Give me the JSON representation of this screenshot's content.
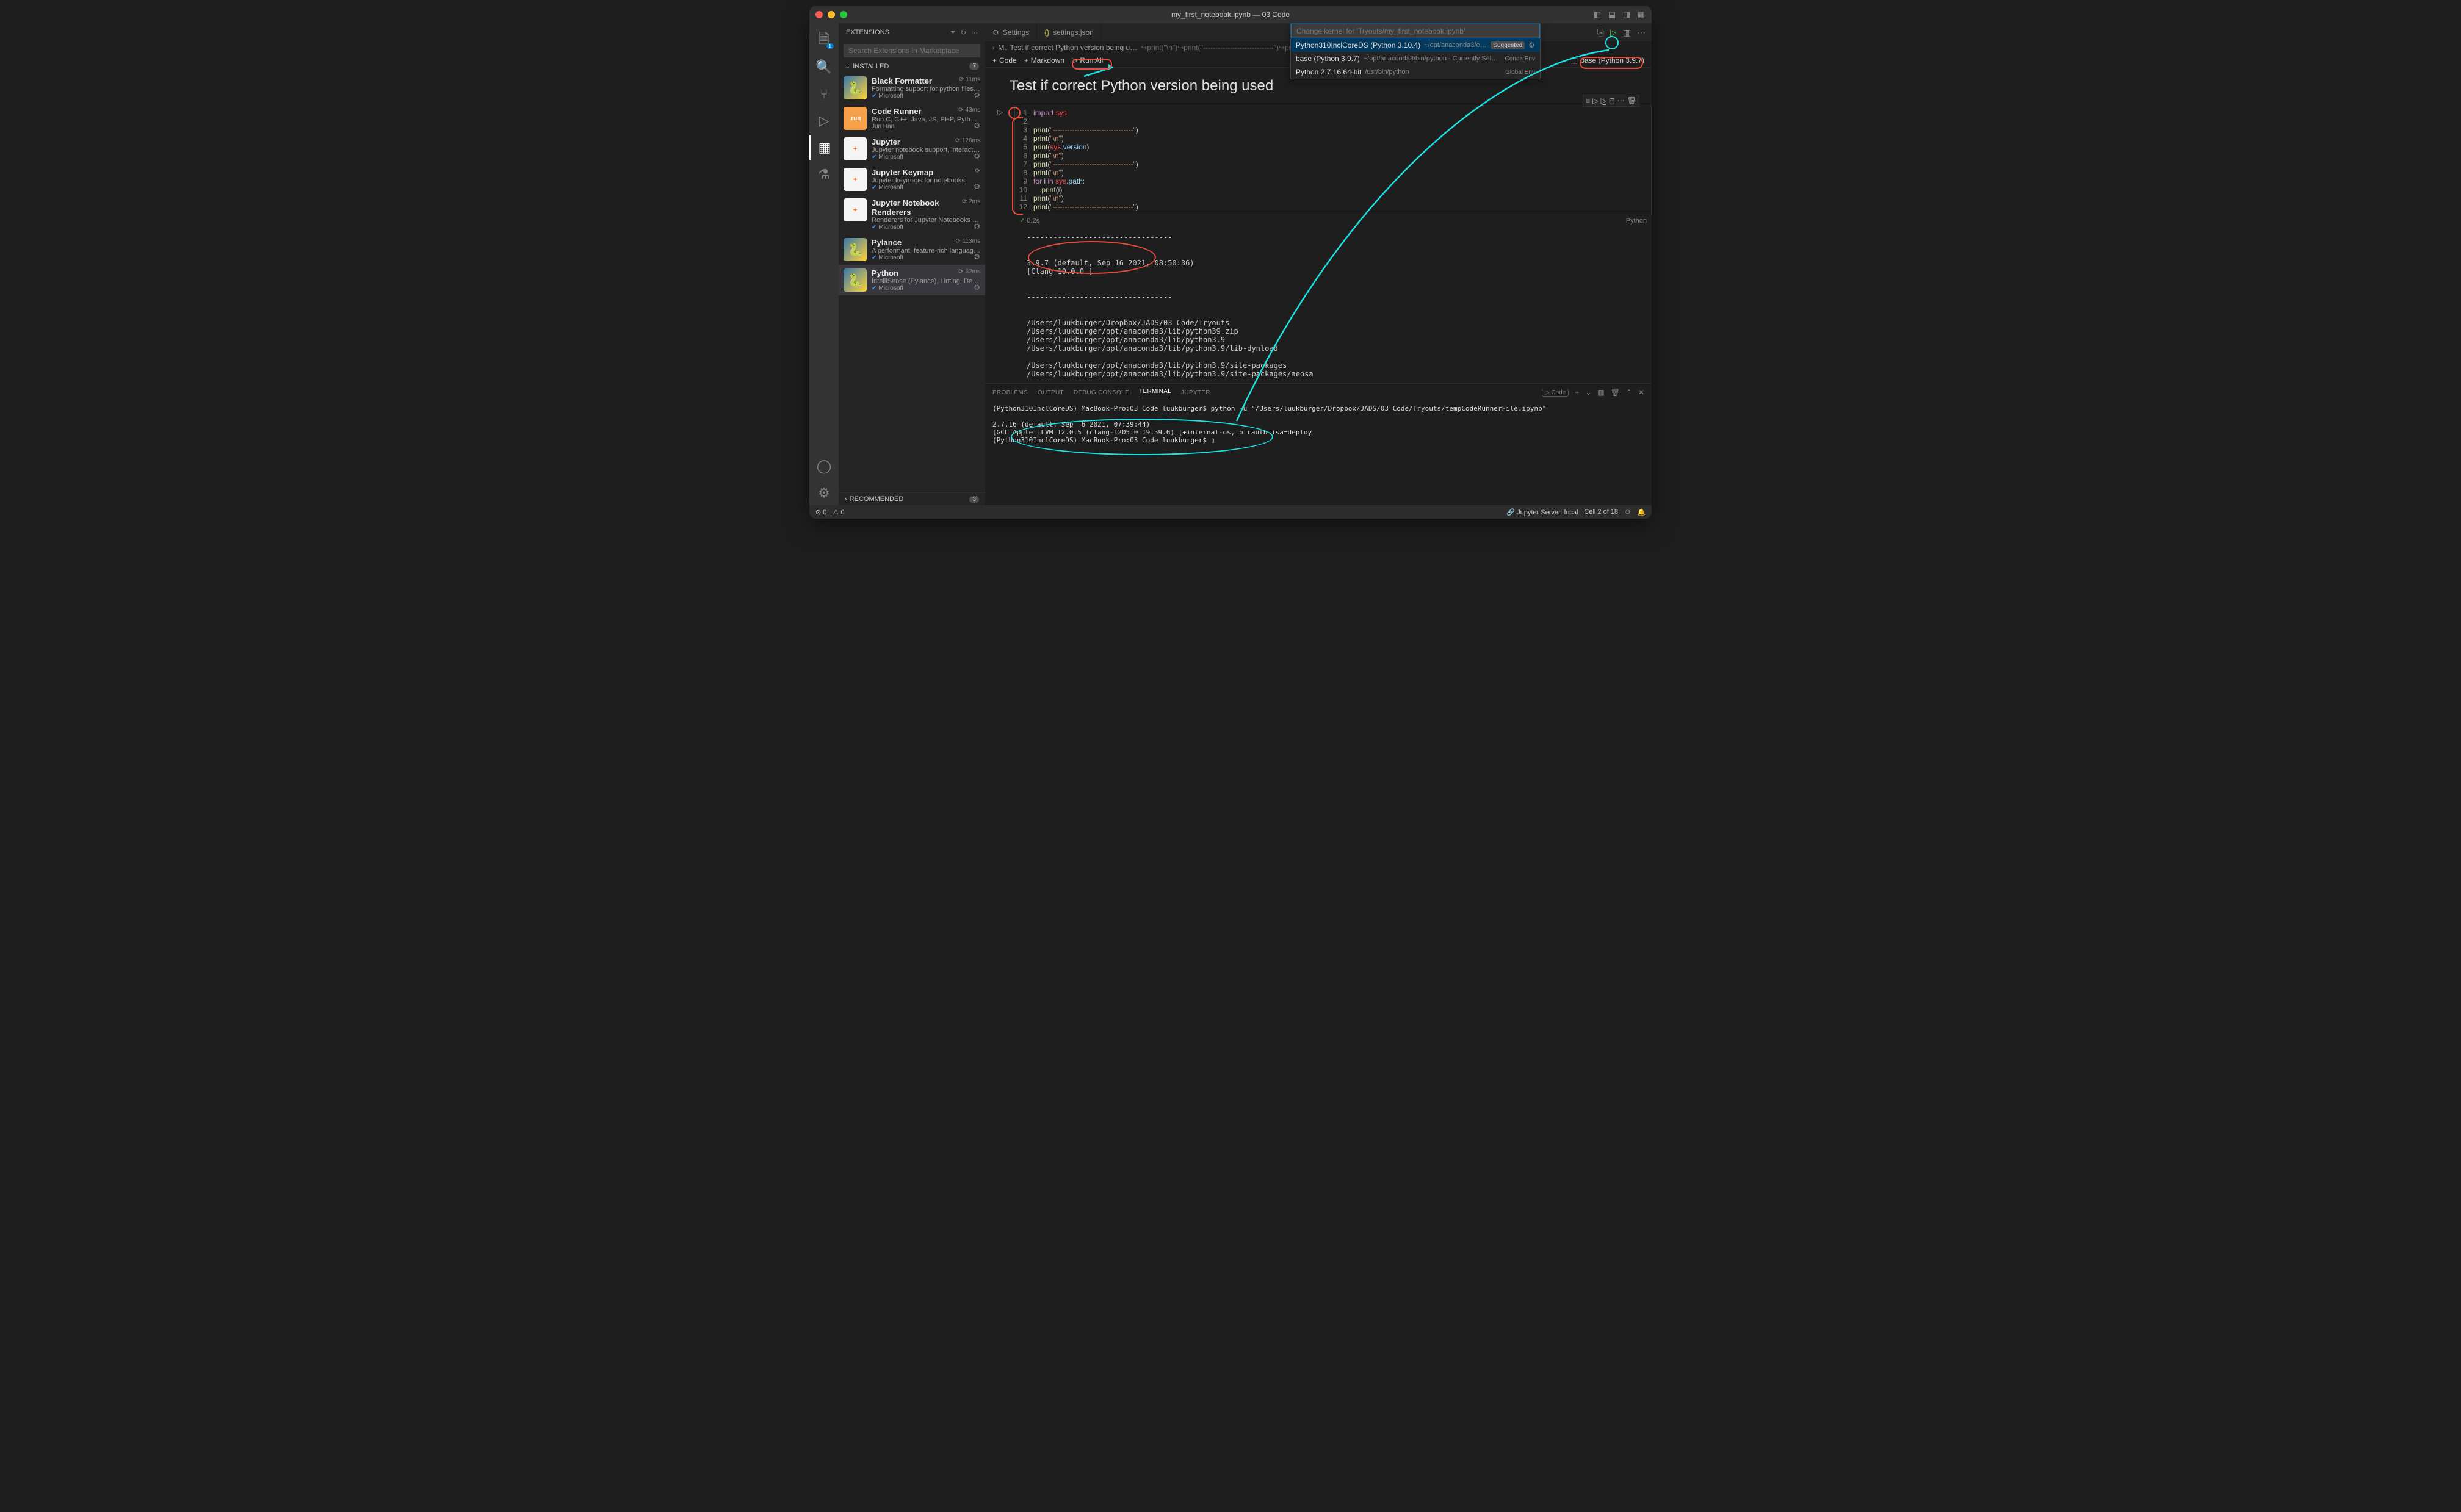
{
  "titlebar": {
    "title": "my_first_notebook.ipynb — 03 Code"
  },
  "sidebar": {
    "title": "EXTENSIONS",
    "searchPlaceholder": "Search Extensions in Marketplace",
    "installed": {
      "label": "INSTALLED",
      "count": "7"
    },
    "recommended": {
      "label": "RECOMMENDED",
      "count": "3"
    },
    "items": [
      {
        "name": "Black Formatter",
        "desc": "Formatting support for python files using `…",
        "pub": "Microsoft",
        "time": "11ms",
        "verified": true
      },
      {
        "name": "Code Runner",
        "desc": "Run C, C++, Java, JS, PHP, Python, Perl, R…",
        "pub": "Jun Han",
        "time": "43ms",
        "verified": false
      },
      {
        "name": "Jupyter",
        "desc": "Jupyter notebook support, interactive pro…",
        "pub": "Microsoft",
        "time": "126ms",
        "verified": true
      },
      {
        "name": "Jupyter Keymap",
        "desc": "Jupyter keymaps for notebooks",
        "pub": "Microsoft",
        "time": "",
        "verified": true
      },
      {
        "name": "Jupyter Notebook Renderers",
        "desc": "Renderers for Jupyter Notebooks (with plo…",
        "pub": "Microsoft",
        "time": "2ms",
        "verified": true
      },
      {
        "name": "Pylance",
        "desc": "A performant, feature-rich language serve…",
        "pub": "Microsoft",
        "time": "113ms",
        "verified": true
      },
      {
        "name": "Python",
        "desc": "IntelliSense (Pylance), Linting, Debugging …",
        "pub": "Microsoft",
        "time": "62ms",
        "verified": true
      }
    ]
  },
  "tabs": {
    "t0": {
      "label": "Settings"
    },
    "t1": {
      "label": "settings.json"
    }
  },
  "kernelPicker": {
    "placeholder": "Change kernel for 'Tryouts/my_first_notebook.ipynb'",
    "rows": [
      {
        "name": "Python310InclCoreDS (Python 3.10.4)",
        "path": "~/opt/anaconda3/envs/Python310InclCor…",
        "badge": "Suggested",
        "gear": true
      },
      {
        "name": "base (Python 3.9.7)",
        "path": "~/opt/anaconda3/bin/python - Currently Selected",
        "badge": "Conda Env"
      },
      {
        "name": "Python 2.7.16 64-bit",
        "path": "/usr/bin/python",
        "badge": "Global Env"
      }
    ]
  },
  "outline": {
    "text": "M↓ Test if correct Python version being u…",
    "rest": "↪print(\"\\n\")↪print(\"-----------------------------\")↪print(\"\\n\")↪for i in sys.path:↪  print(i)↪prin…"
  },
  "nbToolbar": {
    "code": "Code",
    "markdown": "Markdown",
    "runall": "Run All",
    "kernel": "base (Python 3.9.7)"
  },
  "mdCell": {
    "title": "Test if correct Python version being used"
  },
  "codeLines": [
    {
      "n": "1",
      "html": "<span class='kw'>import</span> <span class='mod'>sys</span>"
    },
    {
      "n": "2",
      "html": ""
    },
    {
      "n": "3",
      "html": "<span class='fn'>print</span>(<span class='str'>\"---------------------------------\"</span>)"
    },
    {
      "n": "4",
      "html": "<span class='fn'>print</span>(<span class='str'>\"\\n\"</span>)"
    },
    {
      "n": "5",
      "html": "<span class='fn'>print</span>(<span class='mod'>sys</span>.<span class='attr'>version</span>)"
    },
    {
      "n": "6",
      "html": "<span class='fn'>print</span>(<span class='str'>\"\\n\"</span>)"
    },
    {
      "n": "7",
      "html": "<span class='fn'>print</span>(<span class='str'>\"---------------------------------\"</span>)"
    },
    {
      "n": "8",
      "html": "<span class='fn'>print</span>(<span class='str'>\"\\n\"</span>)"
    },
    {
      "n": "9",
      "html": "<span class='kw'>for</span> i <span class='kw'>in</span> <span class='mod'>sys</span>.<span class='attr'>path</span>:"
    },
    {
      "n": "10",
      "html": "    <span class='fn'>print</span>(i)"
    },
    {
      "n": "11",
      "html": "<span class='fn'>print</span>(<span class='str'>\"\\n\"</span>)"
    },
    {
      "n": "12",
      "html": "<span class='fn'>print</span>(<span class='str'>\"---------------------------------\"</span>)"
    }
  ],
  "cellStatus": {
    "time": "0.2s",
    "lang": "Python"
  },
  "output": {
    "text": "---------------------------------\n\n\n3.9.7 (default, Sep 16 2021, 08:50:36)\n[Clang 10.0.0 ]\n\n\n---------------------------------\n\n\n/Users/luukburger/Dropbox/JADS/03 Code/Tryouts\n/Users/luukburger/opt/anaconda3/lib/python39.zip\n/Users/luukburger/opt/anaconda3/lib/python3.9\n/Users/luukburger/opt/anaconda3/lib/python3.9/lib-dynload\n\n/Users/luukburger/opt/anaconda3/lib/python3.9/site-packages\n/Users/luukburger/opt/anaconda3/lib/python3.9/site-packages/aeosa"
  },
  "panel": {
    "tabs": {
      "problems": "PROBLEMS",
      "output": "OUTPUT",
      "debug": "DEBUG CONSOLE",
      "terminal": "TERMINAL",
      "jupyter": "JUPYTER"
    },
    "codeTag": "Code",
    "terminal": "(Python310InclCoreDS) MacBook-Pro:03 Code luukburger$ python -u \"/Users/luukburger/Dropbox/JADS/03 Code/Tryouts/tempCodeRunnerFile.ipynb\"\n\n2.7.16 (default, Sep  6 2021, 07:39:44)\n[GCC Apple LLVM 12.0.5 (clang-1205.0.19.59.6) [+internal-os, ptrauth-isa=deploy\n(Python310InclCoreDS) MacBook-Pro:03 Code luukburger$ ▯"
  },
  "statusbar": {
    "errors": "0",
    "warnings": "0",
    "jupyter": "Jupyter Server: local",
    "cell": "Cell 2 of 18"
  }
}
